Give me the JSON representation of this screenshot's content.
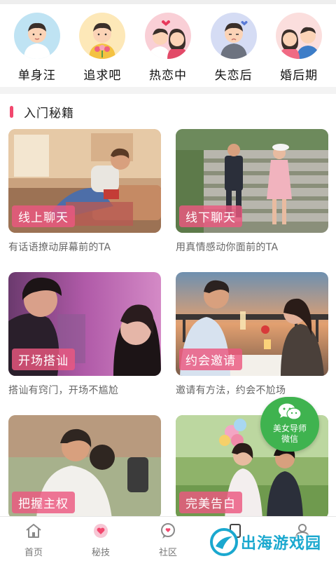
{
  "categories": [
    {
      "label": "单身汪",
      "icon": "single-person-avatar-icon",
      "bg": "#bfe3f3"
    },
    {
      "label": "追求吧",
      "icon": "pursuit-avatar-icon",
      "bg": "#fde8b8"
    },
    {
      "label": "热恋中",
      "icon": "couple-in-love-avatar-icon",
      "bg": "#f9cfd6"
    },
    {
      "label": "失恋后",
      "icon": "heartbroken-avatar-icon",
      "bg": "#d5dcf4"
    },
    {
      "label": "婚后期",
      "icon": "married-couple-avatar-icon",
      "bg": "#fbdedd"
    }
  ],
  "section": {
    "title": "入门秘籍",
    "accent": "#f2486e"
  },
  "cards": [
    {
      "tag": "线上聊天",
      "desc": "有话语撩动屏幕前的TA"
    },
    {
      "tag": "线下聊天",
      "desc": "用真情感动你面前的TA"
    },
    {
      "tag": "开场搭讪",
      "desc": "搭讪有窍门，开场不尴尬"
    },
    {
      "tag": "约会邀请",
      "desc": "邀请有方法，约会不尬场"
    },
    {
      "tag": "把握主权",
      "desc": ""
    },
    {
      "tag": "完美告白",
      "desc": ""
    }
  ],
  "wechat": {
    "line1": "美女导师",
    "line2": "微信",
    "color": "#3fb34f"
  },
  "nav": {
    "items": [
      {
        "label": "首页",
        "icon": "home-icon"
      },
      {
        "label": "秘技",
        "icon": "heart-tips-icon"
      },
      {
        "label": "社区",
        "icon": "community-chat-icon"
      },
      {
        "label": "",
        "icon": "tab-icon"
      },
      {
        "label": "",
        "icon": "profile-icon"
      }
    ]
  },
  "watermark": {
    "text": "出海游戏园",
    "color": "#1aa8cf"
  }
}
